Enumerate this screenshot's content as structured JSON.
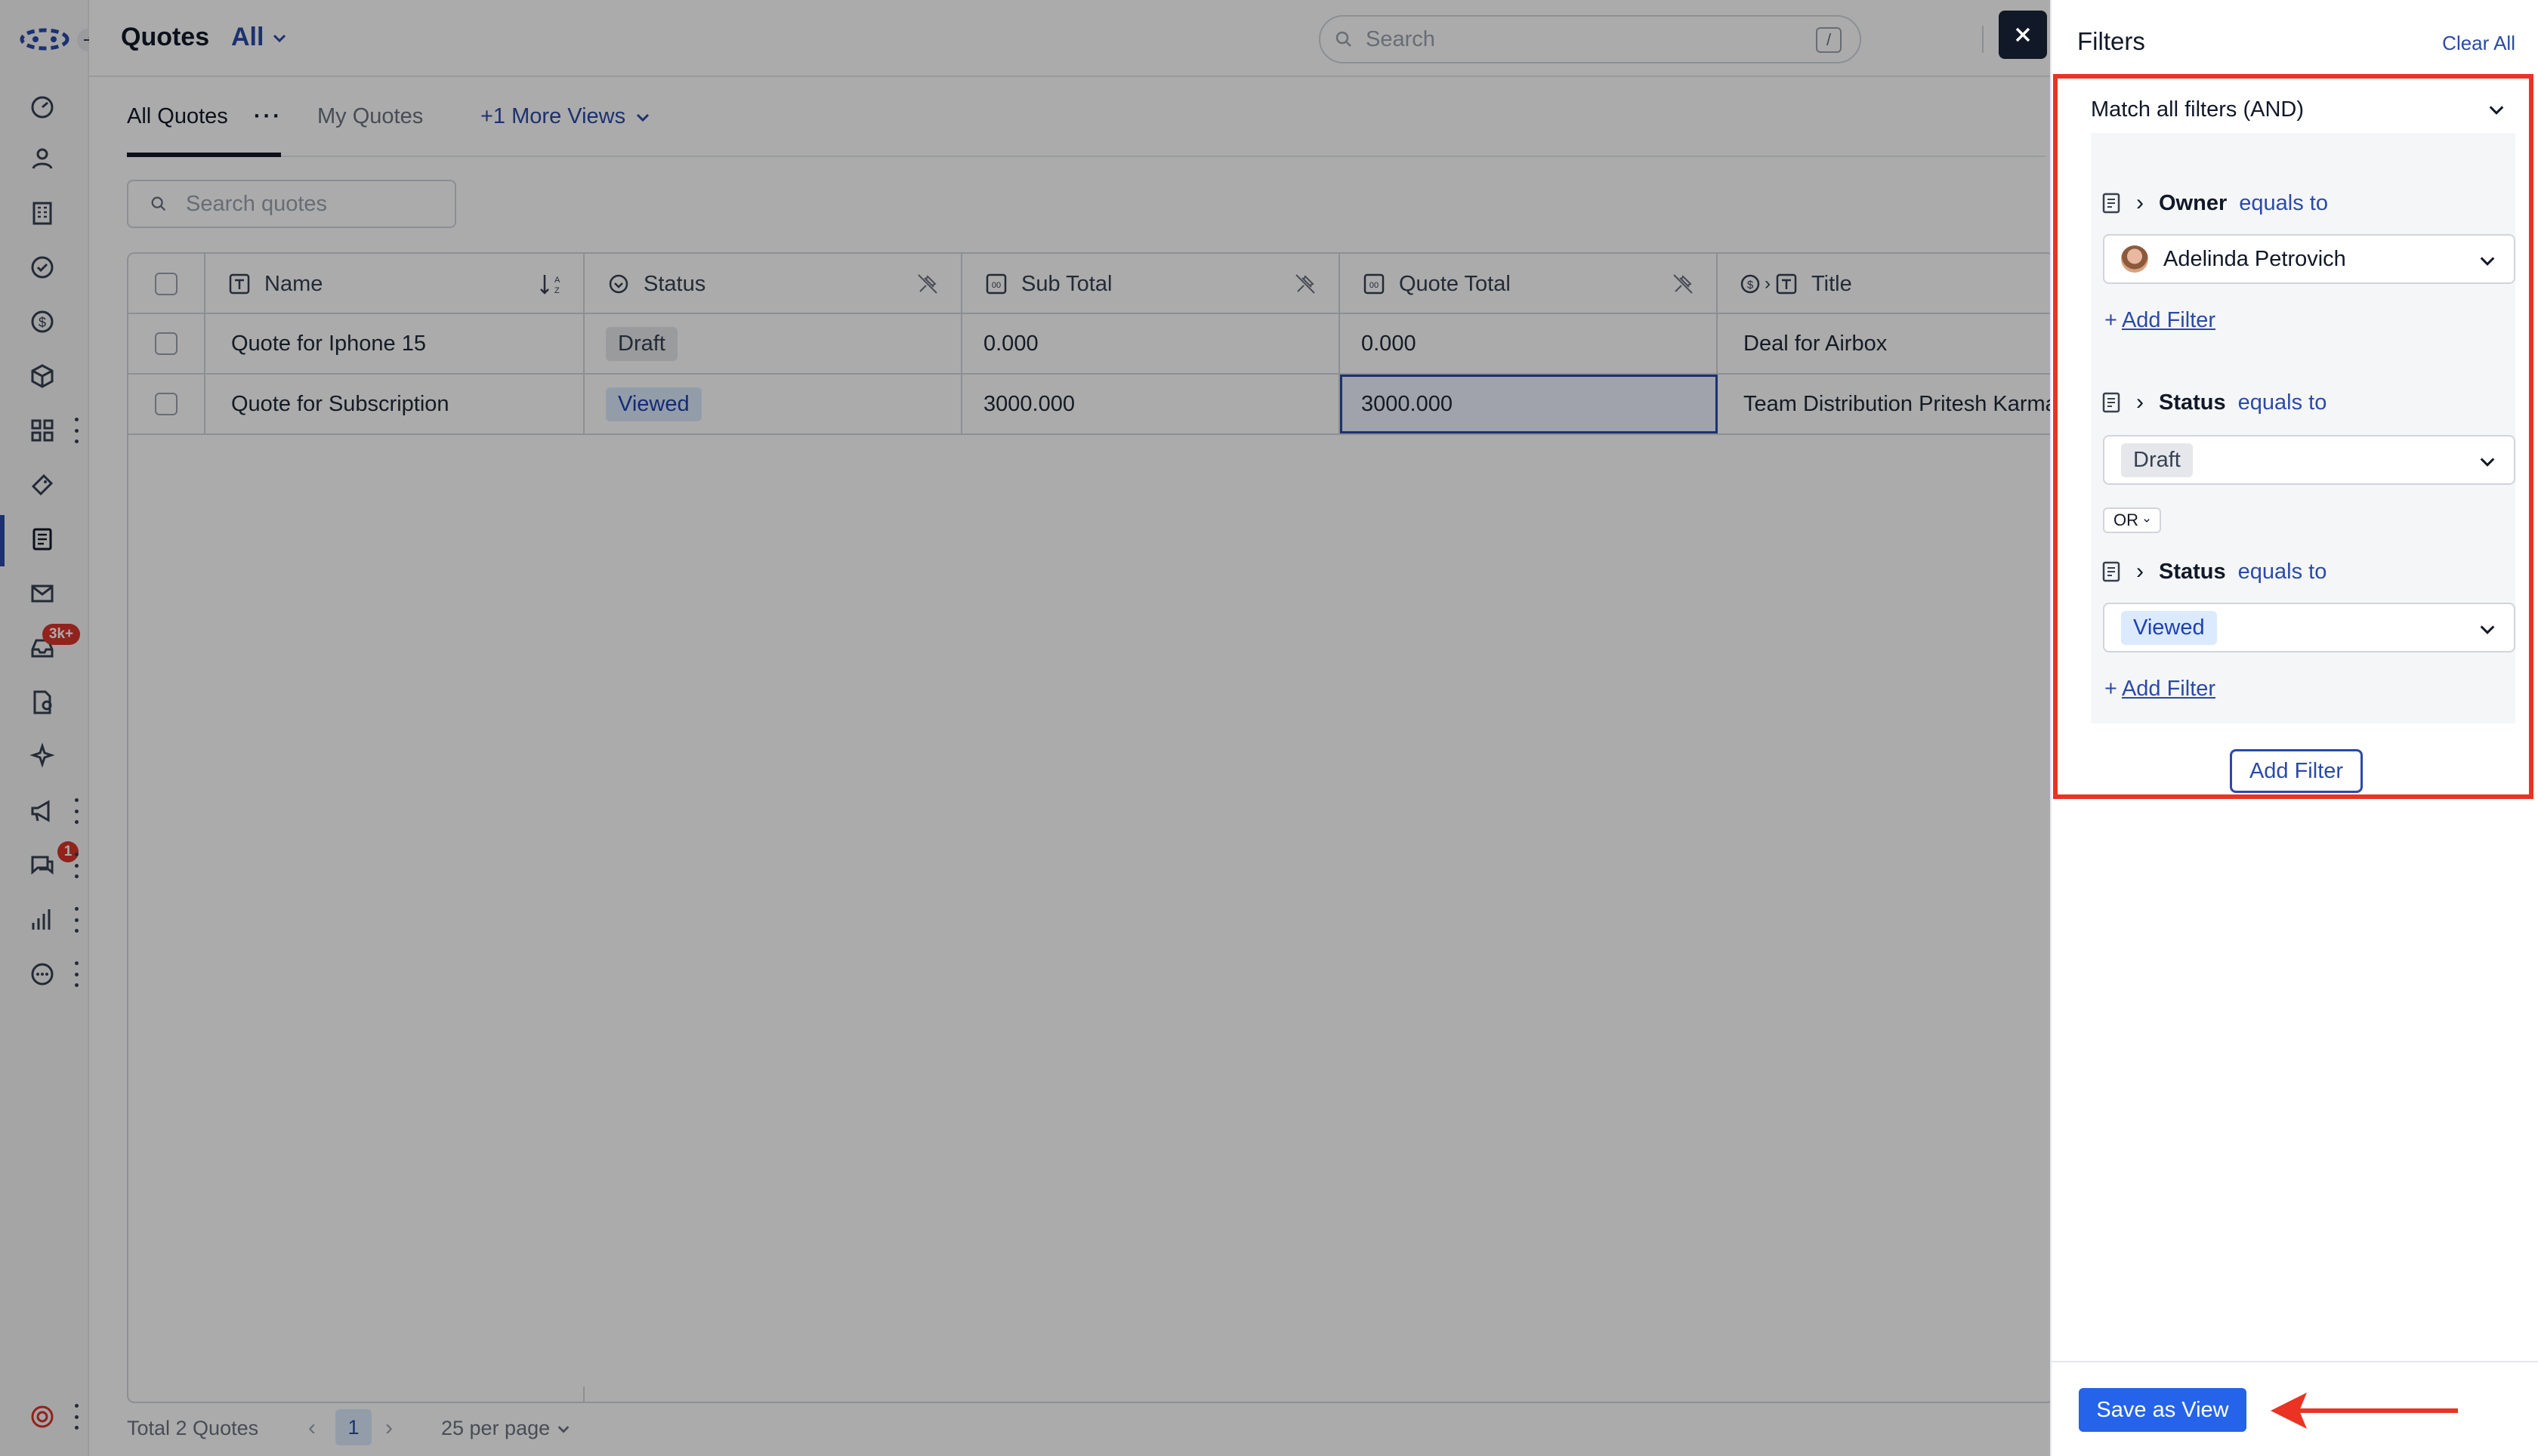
{
  "app": {
    "title": "Quotes",
    "view_label": "All",
    "search_placeholder": "Search",
    "search_shortcut": "/"
  },
  "rail": {
    "badge_inbox": "3k+",
    "badge_chat": "1"
  },
  "tabs": [
    {
      "label": "All Quotes"
    },
    {
      "label": "My Quotes"
    },
    {
      "label": "+1 More Views"
    }
  ],
  "list_search_placeholder": "Search quotes",
  "table": {
    "columns": [
      "Name",
      "Status",
      "Sub Total",
      "Quote Total",
      "Title"
    ],
    "rows": [
      {
        "name": "Quote for Iphone 15",
        "status": "Draft",
        "sub_total": "0.000",
        "quote_total": "0.000",
        "title": "Deal for Airbox"
      },
      {
        "name": "Quote for Subscription",
        "status": "Viewed",
        "sub_total": "3000.000",
        "quote_total": "3000.000",
        "title": "Team Distribution Pritesh Karma"
      }
    ]
  },
  "footer": {
    "total": "Total 2 Quotes",
    "page": "1",
    "per_page": "25 per page"
  },
  "filters": {
    "title": "Filters",
    "clear_all": "Clear All",
    "match_mode": "Match all filters (AND)",
    "rules": [
      {
        "field": "Owner",
        "operator": "equals to",
        "value": "Adelinda Petrovich"
      },
      {
        "field": "Status",
        "operator": "equals to",
        "value": "Draft"
      },
      {
        "field": "Status",
        "operator": "equals to",
        "value": "Viewed"
      }
    ],
    "group_join": "OR",
    "add_filter_link": "Add Filter",
    "add_filter_button": "Add Filter",
    "save_as_view": "Save as View"
  },
  "colors": {
    "accent": "#2b4aa8",
    "highlight": "#ea3323",
    "primary_button": "#2563eb"
  }
}
